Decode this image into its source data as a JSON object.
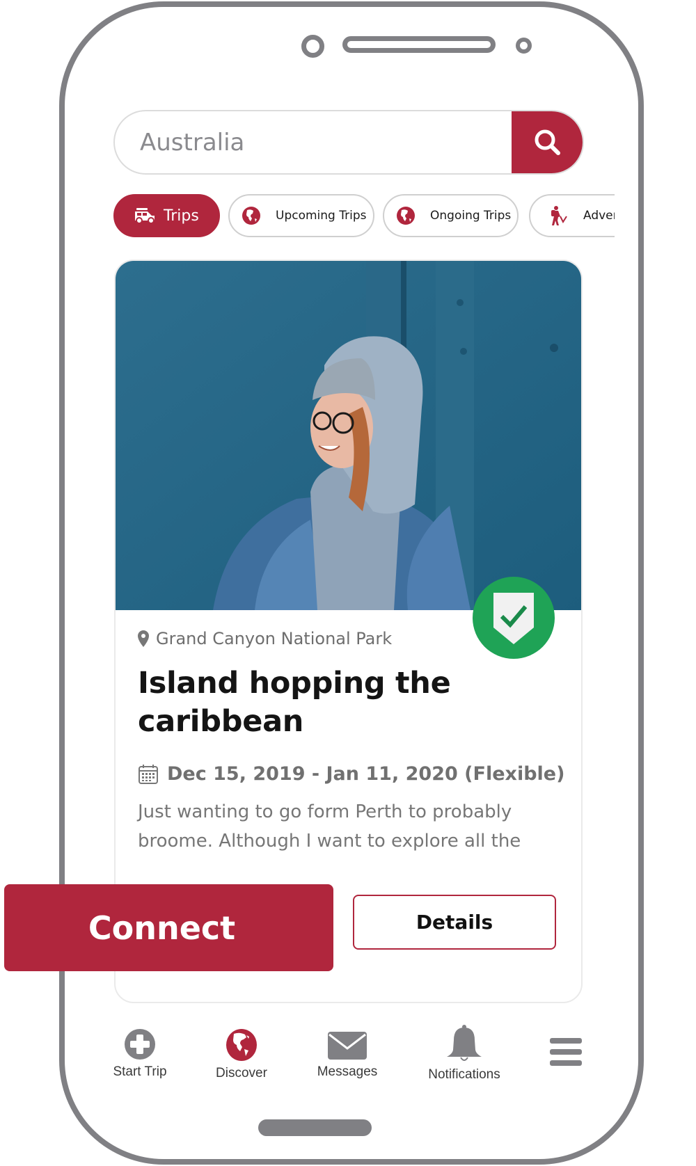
{
  "search": {
    "value": "Australia",
    "placeholder": "Australia",
    "button_icon": "search-icon"
  },
  "chips": [
    {
      "label": "Trips",
      "icon": "car-icon",
      "active": true
    },
    {
      "label": "Upcoming Trips",
      "icon": "globe-icon",
      "active": false
    },
    {
      "label": "Ongoing Trips",
      "icon": "globe-icon",
      "active": false
    },
    {
      "label": "Adven",
      "icon": "hiker-icon",
      "active": false
    }
  ],
  "card": {
    "photo_alt": "Smiling woman in grey hoodie and denim jacket against a blue wall",
    "verified_icon": "verified-shield-check-icon",
    "location": "Grand Canyon National Park",
    "title": "Island hopping the caribbean",
    "dates": "Dec 15, 2019 - Jan 11, 2020 (Flexible)",
    "description": "Just wanting to go form Perth to probably broome. Although I want to explore all the",
    "details_label": "Details"
  },
  "connect_label": "Connect",
  "bottom_nav": [
    {
      "label": "Start Trip",
      "icon": "plus-circle-icon"
    },
    {
      "label": "Discover",
      "icon": "globe-icon"
    },
    {
      "label": "Messages",
      "icon": "envelope-icon"
    },
    {
      "label": "Notifications",
      "icon": "bell-icon"
    },
    {
      "label": "",
      "icon": "hamburger-menu-icon"
    }
  ],
  "colors": {
    "brand": "#b0263d",
    "verified": "#1fa356",
    "frame": "#808084",
    "icon_grey": "#808084"
  }
}
